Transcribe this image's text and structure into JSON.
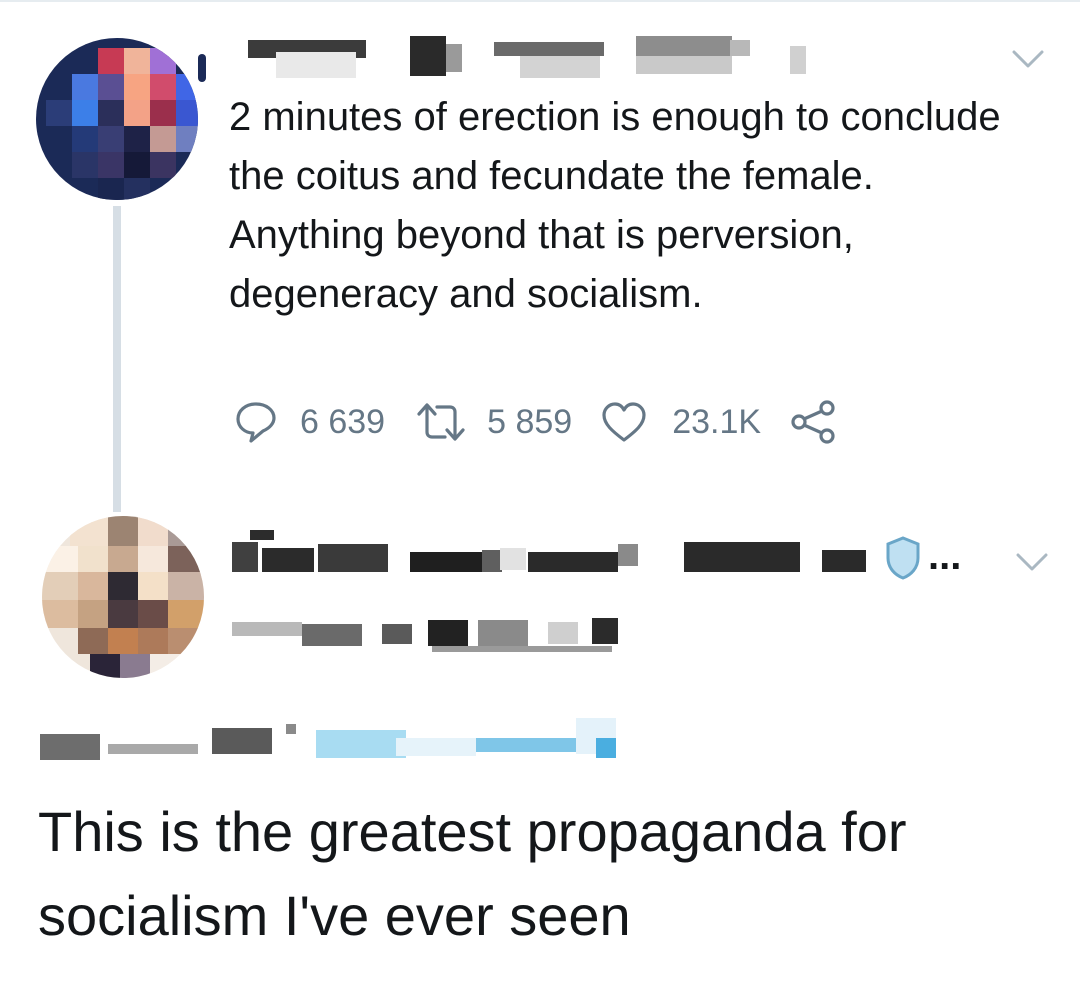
{
  "tweet1": {
    "text": "2 minutes of erection is enough to conclude the coitus and fecundate the female. Anything beyond that is perversion, degeneracy and socialism.",
    "replies": "6 639",
    "retweets": "5 859",
    "likes": "23.1K"
  },
  "tweet2": {
    "name_ellipsis": "...",
    "text": "This is the greatest propaganda for socialism I've ever seen"
  },
  "colors": {
    "text": "#14171a",
    "muted": "#657786",
    "thread_line": "#d6dee5",
    "link_blue": "#1da1f2"
  },
  "icons": [
    "reply-icon",
    "retweet-icon",
    "like-icon",
    "share-icon",
    "chevron-down-icon",
    "verified-badge-icon"
  ]
}
